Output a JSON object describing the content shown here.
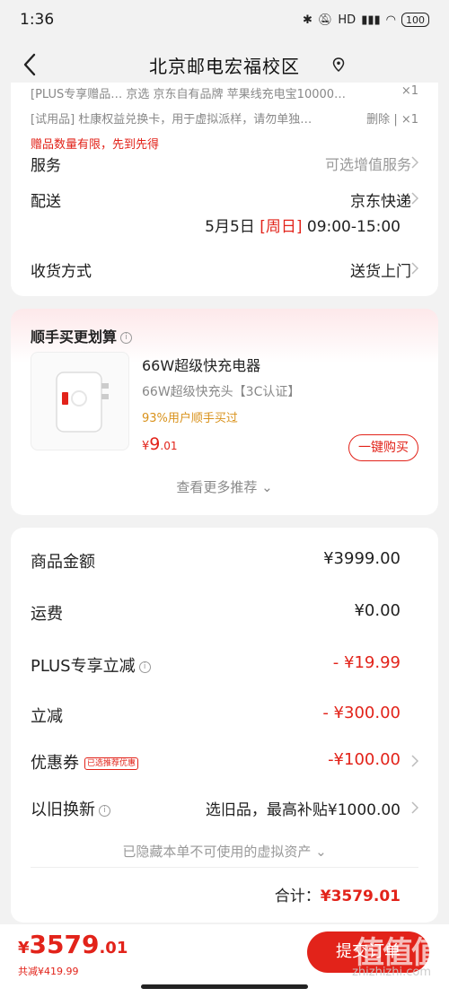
{
  "status": {
    "time": "1:36",
    "network": "HD",
    "battery": "100"
  },
  "header": {
    "title": "北京邮电宏福校区"
  },
  "gifts": [
    {
      "text": "[PLUS专享赠品…  京选 京东自有品牌 苹果线充电宝10000…",
      "count": "×1"
    },
    {
      "text": "[试用品]  杜康权益兑换卡，用于虚拟派样，请勿单独…",
      "delete": "删除",
      "count": "×1"
    }
  ],
  "gift_note": "赠品数量有限，先到先得",
  "service": {
    "label": "服务",
    "value": "可选增值服务"
  },
  "delivery": {
    "label": "配送",
    "value": "京东快递",
    "date": "5月5日",
    "weekday": "[周日]",
    "time": "09:00-15:00"
  },
  "receive": {
    "label": "收货方式",
    "value": "送货上门"
  },
  "addon": {
    "title": "顺手买更划算",
    "product_name": "66W超级快充电器",
    "product_sub": "66W超级快充头【3C认证】",
    "product_tag": "93%用户顺手买过",
    "price_symbol": "¥",
    "price_int": "9",
    "price_dec": ".01",
    "buy_label": "一键购买",
    "more": "查看更多推荐 ⌄"
  },
  "summary": {
    "goods": {
      "label": "商品金额",
      "value": "¥3999.00"
    },
    "shipping": {
      "label": "运费",
      "value": "¥0.00"
    },
    "plus": {
      "label": "PLUS专享立减",
      "value": "- ¥19.99"
    },
    "instant": {
      "label": "立减",
      "value": "- ¥300.00"
    },
    "coupon": {
      "label": "优惠券",
      "tag": "已选推荐优惠",
      "value": "-¥100.00"
    },
    "tradein": {
      "label": "以旧换新",
      "value": "选旧品，最高补贴¥1000.00"
    },
    "hidden_note": "已隐藏本单不可使用的虚拟资产 ⌄",
    "total_label": "合计：",
    "total_value": "¥3579.01"
  },
  "bottom": {
    "price_symbol": "¥",
    "price_int": "3579",
    "price_dec": ".01",
    "discount": "共减¥419.99",
    "submit_label": "提交订单"
  },
  "watermark": {
    "logo": "值值值",
    "url": "zhizhizhi.com"
  },
  "colors": {
    "accent": "#e2231a",
    "gold": "#d9921b"
  }
}
